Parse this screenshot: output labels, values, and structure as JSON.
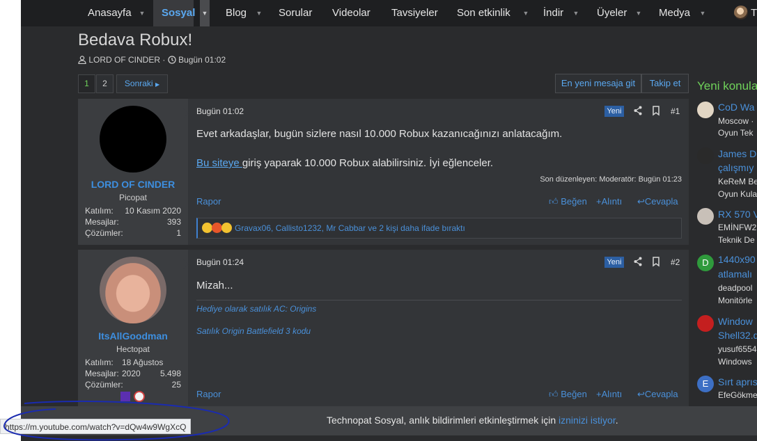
{
  "nav": {
    "items": [
      {
        "label": "Anasayfa",
        "caret": true
      },
      {
        "label": "Sosyal",
        "caret": true,
        "active": true
      },
      {
        "label": "Blog",
        "caret": true
      },
      {
        "label": "Sorular",
        "caret": false
      },
      {
        "label": "Videolar",
        "caret": false
      },
      {
        "label": "Tavsiyeler",
        "caret": false
      },
      {
        "label": "Son etkinlik",
        "caret": true
      },
      {
        "label": "İndir",
        "caret": true
      },
      {
        "label": "Üyeler",
        "caret": true
      },
      {
        "label": "Medya",
        "caret": true
      }
    ],
    "user_initial": "T"
  },
  "thread": {
    "title": "Bedava Robux!",
    "author": "LORD OF CINDER",
    "separator": "·",
    "date": "Bugün 01:02"
  },
  "pager": {
    "page1": "1",
    "page2": "2",
    "next": "Sonraki"
  },
  "buttons": {
    "newest": "En yeni mesaja git",
    "follow": "Takip et"
  },
  "posts": [
    {
      "date": "Bugün 01:02",
      "badge": "Yeni",
      "number": "#1",
      "user": {
        "name": "LORD OF CINDER",
        "title": "Picopat",
        "joined_label": "Katılım:",
        "joined": "10 Kasım 2020",
        "messages_label": "Mesajlar:",
        "messages": "393",
        "solutions_label": "Çözümler:",
        "solutions": "1"
      },
      "line1": "Evet arkadaşlar, bugün sizlere nasıl 10.000 Robux kazanıcağınızı anlatacağım.",
      "link_text": "Bu siteye ",
      "line2_rest": "giriş yaparak 10.000 Robux alabilirsiniz. İyi eğlenceler.",
      "edited": "Son düzenleyen: Moderatör: Bugün 01:23",
      "report": "Rapor",
      "like": "Beğen",
      "quote": "+Alıntı",
      "reply": "Cevapla",
      "reactions": "Gravax06, Callisto1232, Mr Cabbar ve 2 kişi daha ifade bıraktı"
    },
    {
      "date": "Bugün 01:24",
      "badge": "Yeni",
      "number": "#2",
      "user": {
        "name": "ItsAllGoodman",
        "title": "Hectopat",
        "joined_label": "Katılım:",
        "joined": "18 Ağustos 2020",
        "messages_label": "Mesajlar:",
        "messages": "5.498",
        "solutions_label": "Çözümler:",
        "solutions": "25"
      },
      "line1": "Mizah...",
      "sig1": "Hediye olarak satılık AC: Origins",
      "sig2": "Satılık Origin Battlefield 3 kodu",
      "report": "Rapor",
      "like": "Beğen",
      "quote": "+Alıntı",
      "reply": "Cevapla"
    }
  ],
  "sidebar": {
    "title": "Yeni konular",
    "items": [
      {
        "title": "CoD Wa",
        "sub1": "Moscow ·",
        "sub2": "Oyun Tek",
        "avatar": "",
        "color": "#e2d6c4"
      },
      {
        "title": "James D",
        "title2": "çalışmıy",
        "sub1": "KeReM Be",
        "sub2": "Oyun Kula",
        "avatar": "",
        "color": "#2a2a2a"
      },
      {
        "title": "RX 570 V",
        "sub1": "EMİNFW2",
        "sub2": "Teknik De",
        "avatar": "",
        "color": "#c8c0b8"
      },
      {
        "title": "1440x90",
        "title2": "atlamalı",
        "sub1": "deadpool",
        "sub2": "Monitörle",
        "avatar": "D",
        "color": "#2f9a3c"
      },
      {
        "title": "Window",
        "title2": "Shell32.d",
        "sub1": "yusuf6554",
        "sub2": "Windows",
        "avatar": "",
        "color": "#c41f1f"
      },
      {
        "title": "Sırt aprıs",
        "sub1": "EfeGökme",
        "avatar": "E",
        "color": "#3d6fc4"
      }
    ]
  },
  "notification": {
    "text": "Technopat Sosyal, anlık bildirimleri etkinleştirmek için ",
    "link": "izninizi istiyor",
    "end": "."
  },
  "status_url": "https://m.youtube.com/watch?v=dQw4w9WgXcQ",
  "colors": {
    "accent": "#4a90d9",
    "active_nav": "#5aa8f0",
    "sidebar_title": "#6fd25a",
    "new_badge": "#2c5fa3",
    "background": "#2a2b2d"
  }
}
